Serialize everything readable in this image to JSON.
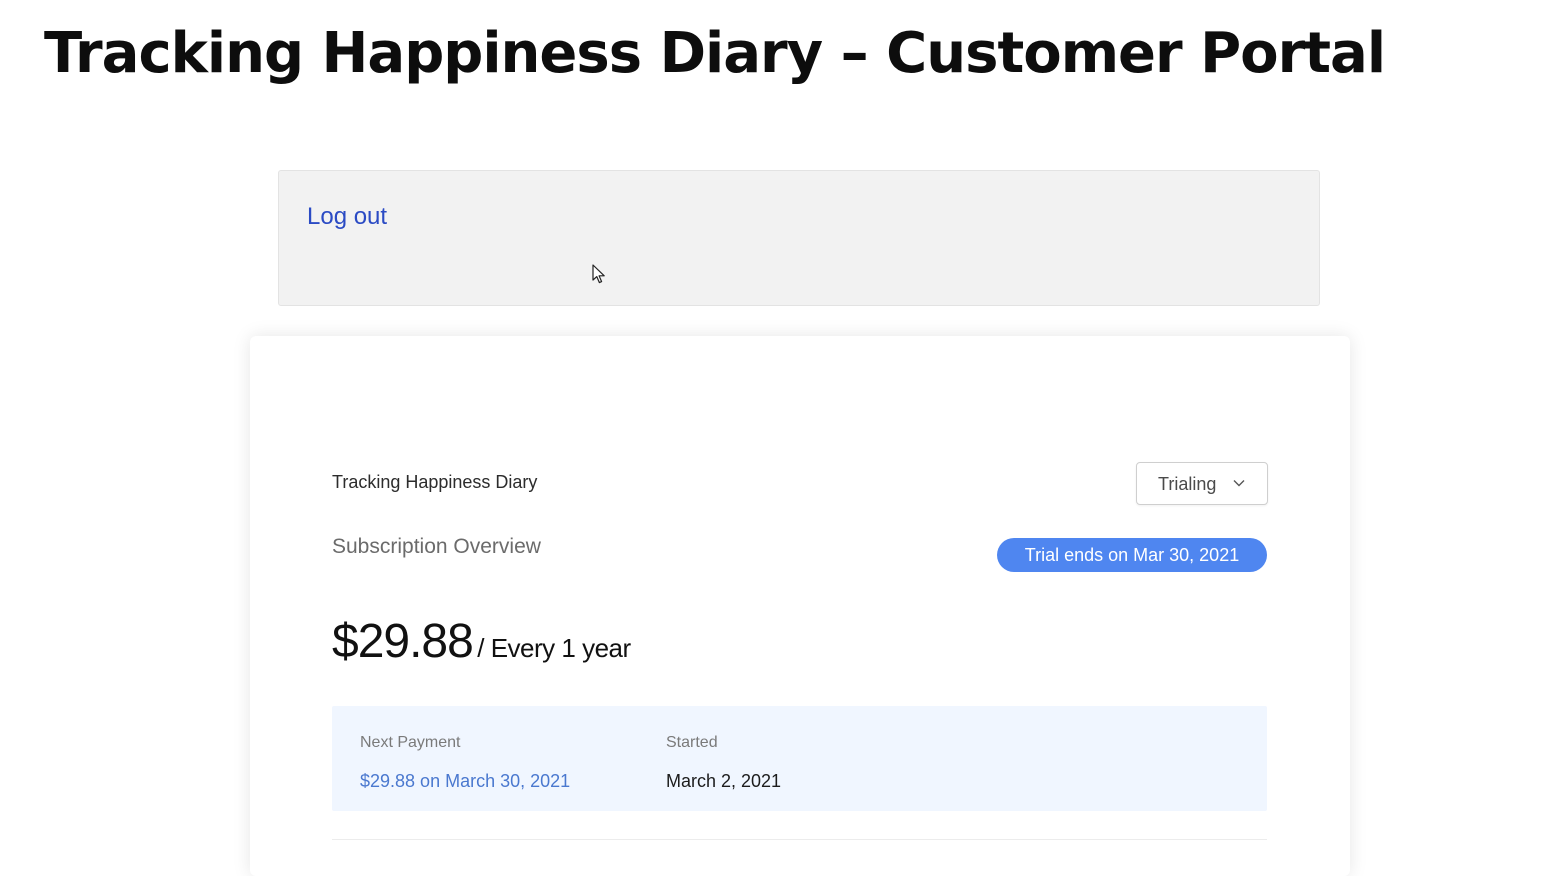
{
  "page": {
    "title": "Tracking Happiness Diary – Customer Portal"
  },
  "account": {
    "logout_label": "Log out"
  },
  "subscription": {
    "product_name": "Tracking Happiness Diary",
    "status": "Trialing",
    "overview_title": "Subscription Overview",
    "trial_badge": "Trial ends on Mar 30, 2021",
    "price": "$29.88",
    "interval": "/ Every 1 year",
    "next_payment_label": "Next Payment",
    "next_payment_value": "$29.88 on March 30, 2021",
    "started_label": "Started",
    "started_value": "March 2, 2021"
  },
  "icons": {
    "status_dropdown": "chevron-down-icon",
    "pointer": "mouse-cursor-icon"
  },
  "colors": {
    "link": "#2b4bc4",
    "badge": "#4f86f0",
    "panel_background": "#f0f6ff",
    "accent_value": "#4a78cf"
  }
}
